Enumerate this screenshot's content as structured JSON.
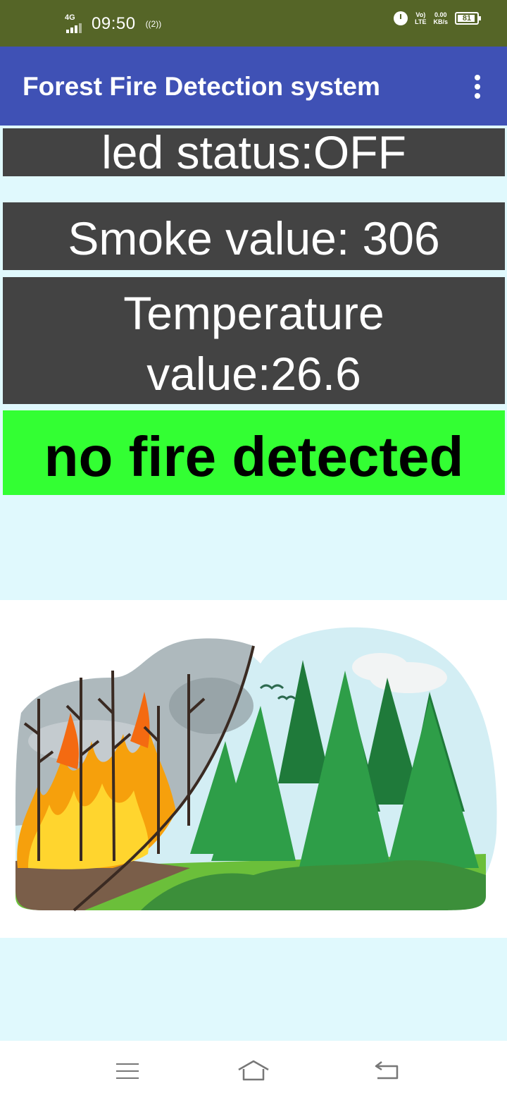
{
  "status_bar": {
    "network": "4G",
    "time": "09:50",
    "hotspot": "((2))",
    "volte_top": "Vo)",
    "volte_bottom": "LTE",
    "speed_value": "0.00",
    "speed_unit": "KB/s",
    "battery": "81",
    "icons": [
      "signal-icon",
      "hotspot-icon",
      "alarm-icon",
      "volte-icon",
      "battery-icon"
    ]
  },
  "app_bar": {
    "title": "Forest Fire Detection system",
    "menu_icon": "more-vert-icon"
  },
  "readings": {
    "led_status": "led status:OFF",
    "smoke": "Smoke value: 306",
    "temperature_line1": "Temperature",
    "temperature_line2": "value:26.6"
  },
  "alert": {
    "text": "no fire detected",
    "color": "#33ff33"
  },
  "illustration": {
    "subject": "forest-fire-illustration"
  },
  "nav_bar": {
    "icons": [
      "menu-icon",
      "home-icon",
      "back-icon"
    ]
  },
  "colors": {
    "status_bar": "#556527",
    "app_bar": "#3f51b5",
    "tile": "#434343",
    "background": "#e0f9fd"
  }
}
